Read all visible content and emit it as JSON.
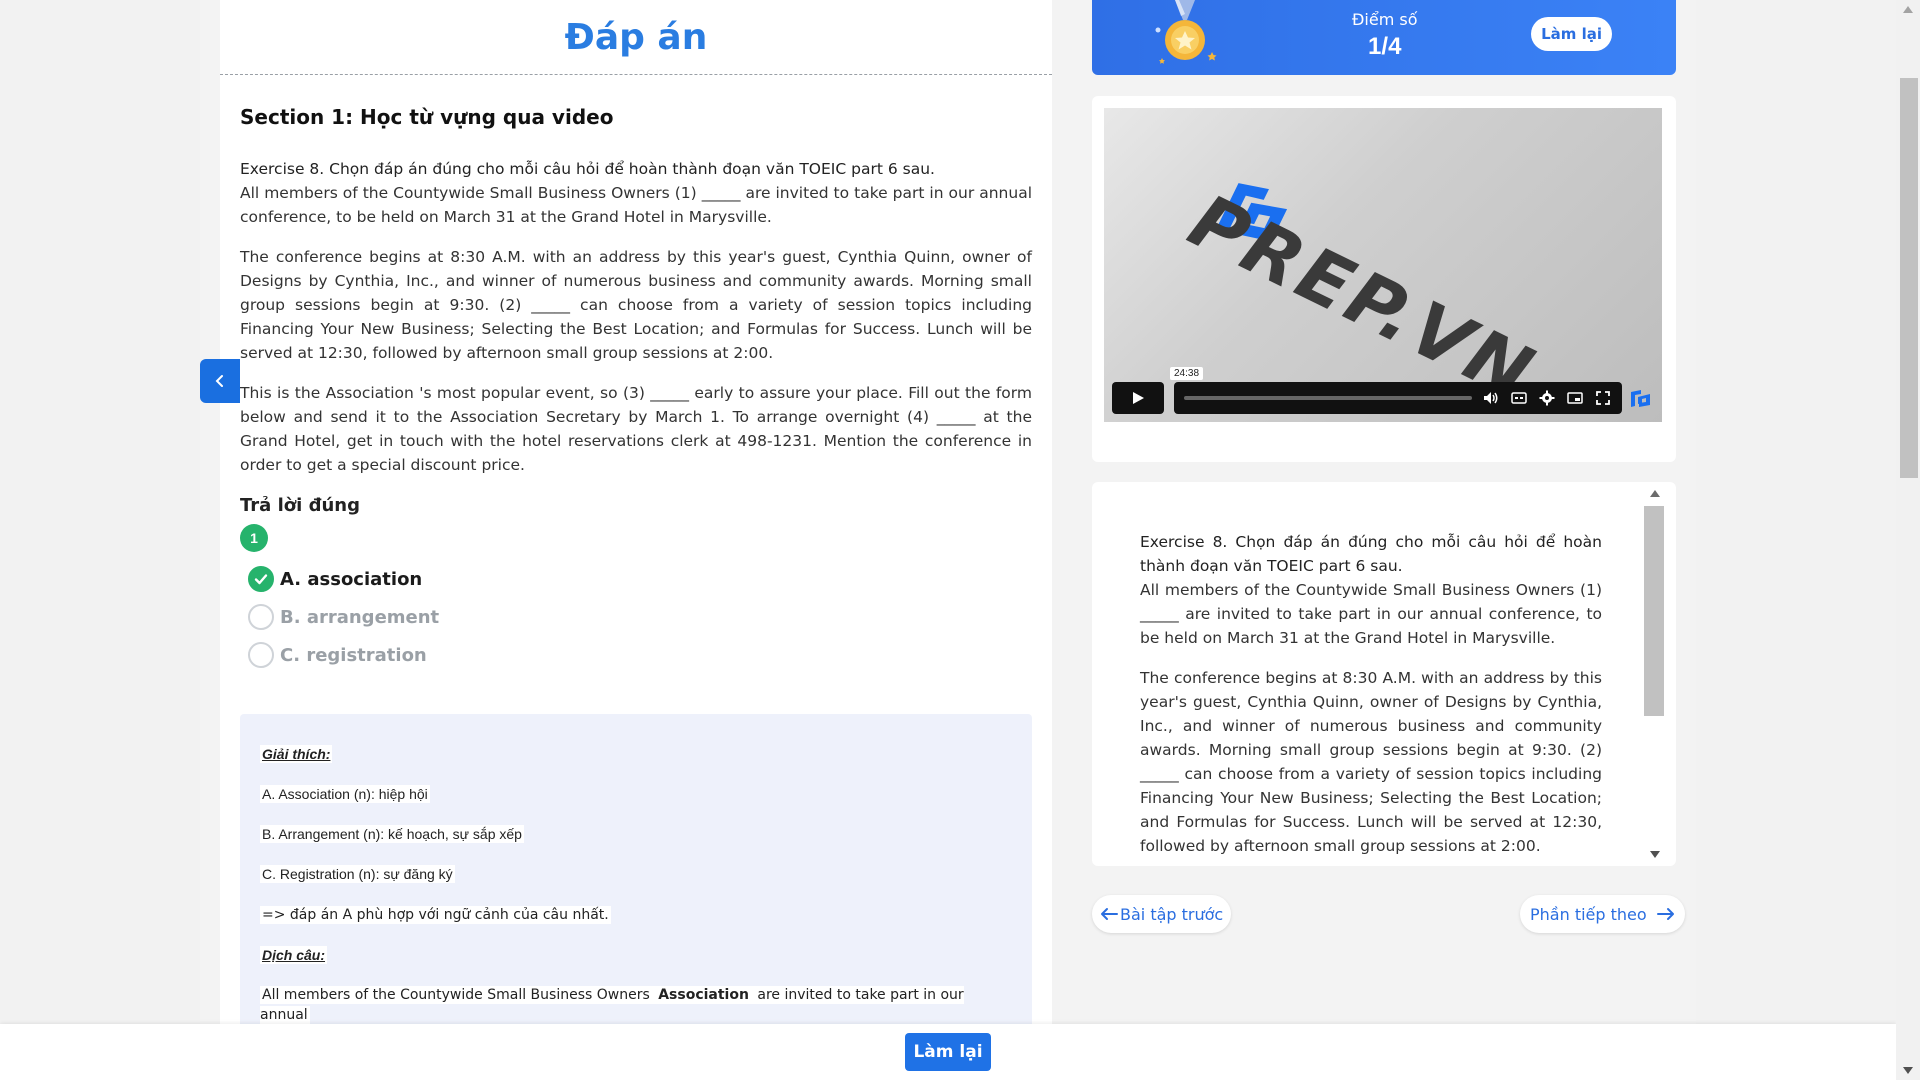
{
  "page": {
    "title": "Đáp án"
  },
  "left": {
    "section_title": "Section 1: Học từ vựng qua video",
    "exercise_intro": "Exercise 8. Chọn đáp án đúng cho mỗi câu hỏi để hoàn thành đoạn văn TOEIC part 6 sau.",
    "p1": "All members of the Countywide Small Business Owners (1) _____ are invited to take part in our annual conference, to be held on March 31 at the Grand Hotel in Marysville.",
    "p2": "The conference begins at 8:30 A.M. with an address by this year's guest, Cynthia Quinn, owner of Designs by Cynthia, Inc., and winner of numerous business and community awards. Morning small group sessions begin at 9:30. (2) _____ can choose from a variety of session topics including Financing Your New Business; Selecting the Best Location; and Formulas for Success. Lunch will be served at 12:30, followed by afternoon small group sessions at 2:00.",
    "p3": "This is the Association 's most popular event, so (3) _____ early to assure your place. Fill out the form below and send it to the Association Secretary by March 1. To arrange overnight (4) _____ at the Grand Hotel, get in touch with the hotel reservations clerk at 498-1231. Mention the conference in order to get a special discount price.",
    "answer_heading": "Trả lời đúng",
    "question_number": "1",
    "options": [
      {
        "label": "A. association",
        "correct": true
      },
      {
        "label": "B. arrangement",
        "correct": false
      },
      {
        "label": "C. registration",
        "correct": false
      }
    ],
    "explanation": {
      "heading": "Giải thích:",
      "a": "A. Association (n): hiệp hội",
      "b": "B. Arrangement (n): kế hoạch, sự sắp xếp",
      "c": "C. Registration (n): sự đăng ký",
      "conclusion": "=> đáp án A phù hợp với ngữ cảnh của câu nhất.",
      "translation_heading": "Dịch câu:",
      "translation_pre": "All members of the Countywide Small Business Owners ",
      "translation_bold": "Association",
      "translation_post": " are invited to take part in our annual"
    }
  },
  "score": {
    "label": "Điểm số",
    "value": "1/4",
    "retry_label": "Làm lại"
  },
  "video": {
    "brand_text": "PREP.VN",
    "timecode": "24:38",
    "mini_logo_text": "PREP.VN"
  },
  "right_text": {
    "exercise_intro": "Exercise 8. Chọn đáp án đúng cho mỗi câu hỏi để hoàn thành đoạn văn TOEIC part 6 sau.",
    "p1": "All members of the Countywide Small Business Owners (1) _____ are invited to take part in our annual conference, to be held on March 31 at the Grand Hotel in Marysville.",
    "p2": "The conference begins at 8:30 A.M. with an address by this year's guest, Cynthia Quinn, owner of Designs by Cynthia, Inc., and winner of numerous business and community awards. Morning small group sessions begin at 9:30. (2) _____ can choose from a variety of session topics including Financing Your New Business; Selecting the Best Location; and Formulas for Success. Lunch will be served at 12:30, followed by afternoon small group sessions at 2:00."
  },
  "nav": {
    "prev_label": "Bài tập trước",
    "next_label": "Phần tiếp theo"
  },
  "bottom": {
    "retry_label": "Làm lại"
  },
  "colors": {
    "accent": "#2a6ee0",
    "title_blue": "#2a7de1",
    "correct_green": "#26b36c",
    "explain_bg": "#eef1fb"
  }
}
